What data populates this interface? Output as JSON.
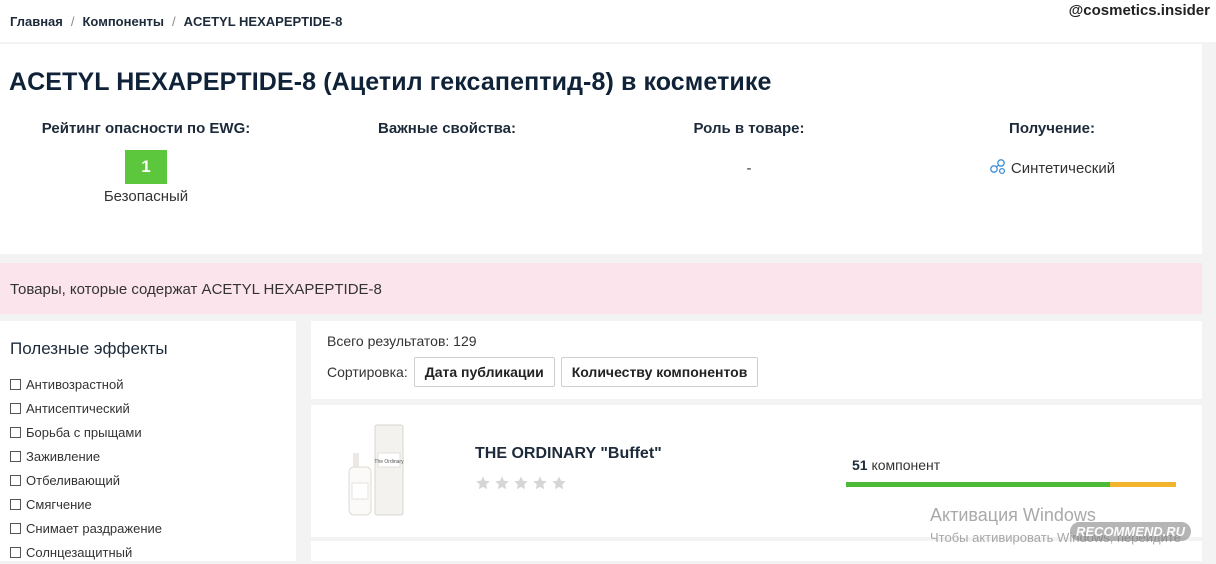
{
  "breadcrumbs": [
    "Главная",
    "Компоненты",
    "ACETYL HEXAPEPTIDE-8"
  ],
  "watermark_user": "@cosmetics.insider",
  "title": "ACETYL HEXAPEPTIDE-8 (Ацетил гексапептид-8) в косметике",
  "summary": {
    "ewg": {
      "header": "Рейтинг опасности по EWG:",
      "score": "1",
      "label": "Безопасный",
      "color": "#5cc73d"
    },
    "properties": {
      "header": "Важные свойства:"
    },
    "role": {
      "header": "Роль в товаре:",
      "value": "-"
    },
    "origin": {
      "header": "Получение:",
      "value": "Синтетический",
      "icon": "molecule-icon"
    }
  },
  "products_banner": "Товары, которые содержат ACETYL HEXAPEPTIDE-8",
  "filters": {
    "title": "Полезные эффекты",
    "items": [
      "Антивозрастной",
      "Антисептический",
      "Борьба с прыщами",
      "Заживление",
      "Отбеливающий",
      "Смягчение",
      "Снимает раздражение",
      "Солнцезащитный"
    ]
  },
  "results": {
    "total": "Всего результатов: 129",
    "sort_label": "Сортировка:",
    "sort_options": [
      "Дата публикации",
      "Количеству компонентов"
    ]
  },
  "product": {
    "name": "THE ORDINARY \"Buffet\"",
    "rating": 0,
    "component_count": "51",
    "component_label": "компонент",
    "bar_green_fraction": 0.8,
    "bar_colors": {
      "green": "#4cba36",
      "orange": "#f3b42c"
    }
  },
  "watermarks": {
    "windows_line1": "Активация Windows",
    "windows_line2": "Чтобы активировать Windows, перейдите",
    "site": "RECOMMEND.RU"
  }
}
